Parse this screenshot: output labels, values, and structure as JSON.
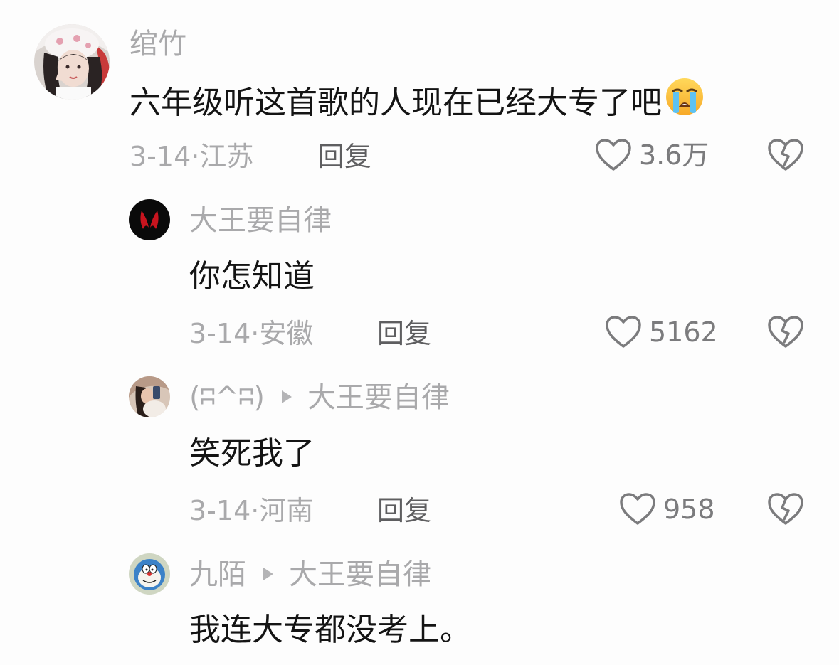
{
  "comments": [
    {
      "author": "绾竹",
      "text": "六年级听这首歌的人现在已经大专了吧",
      "emoji": "loudly-crying-face",
      "date": "3-14",
      "location": "江苏",
      "reply_label": "回复",
      "likes": "3.6万"
    },
    {
      "author": "大王要自律",
      "text": "你怎知道",
      "date": "3-14",
      "location": "安徽",
      "reply_label": "回复",
      "likes": "5162"
    },
    {
      "author": "(ʭ^ʭ)",
      "reply_to": "大王要自律",
      "text": "笑死我了",
      "date": "3-14",
      "location": "河南",
      "reply_label": "回复",
      "likes": "958"
    },
    {
      "author": "九陌",
      "reply_to": "大王要自律",
      "text": "我连大专都没考上。"
    }
  ],
  "colors": {
    "meta_gray": "#a9a9ab",
    "reply_gray": "#5e5e60",
    "text_black": "#141414",
    "icon_gray": "#7b7b7d"
  },
  "icons": {
    "like": "heart-outline-icon",
    "dislike": "broken-heart-icon",
    "reply_arrow": "triangle-right-icon"
  }
}
